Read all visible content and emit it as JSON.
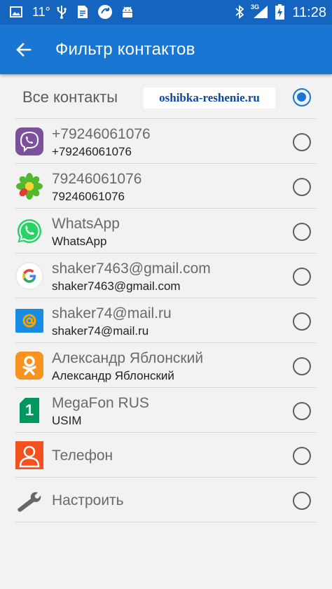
{
  "status_bar": {
    "temperature": "11°",
    "network": "3G",
    "time": "11:28"
  },
  "app_bar": {
    "title": "Фильтр контактов"
  },
  "all_contacts": {
    "label": "Все контакты",
    "watermark": "oshibka-reshenie.ru",
    "selected": true
  },
  "accounts": [
    {
      "icon": "viber-icon",
      "title": "+79246061076",
      "subtitle": "+79246061076"
    },
    {
      "icon": "icq-icon",
      "title": "79246061076",
      "subtitle": "79246061076"
    },
    {
      "icon": "whatsapp-icon",
      "title": "WhatsApp",
      "subtitle": "WhatsApp"
    },
    {
      "icon": "google-icon",
      "title": "shaker7463@gmail.com",
      "subtitle": "shaker7463@gmail.com"
    },
    {
      "icon": "mailru-icon",
      "title": "shaker74@mail.ru",
      "subtitle": "shaker74@mail.ru"
    },
    {
      "icon": "odnoklassniki-icon",
      "title": "Александр Яблонский",
      "subtitle": "Александр Яблонский"
    },
    {
      "icon": "sim-card-icon",
      "sim_number": "1",
      "title": "MegaFon RUS",
      "subtitle": "USIM"
    },
    {
      "icon": "phone-contact-icon",
      "title": "Телефон"
    },
    {
      "icon": "wrench-icon",
      "title": "Настроить"
    }
  ],
  "colors": {
    "status_bar": "#1565c0",
    "app_bar": "#1976d2",
    "radio_selected": "#1976d2",
    "viber": "#7b519d",
    "whatsapp": "#25d366",
    "mailru": "#168de2",
    "odnoklassniki": "#f7931e",
    "megafon": "#00985f"
  }
}
